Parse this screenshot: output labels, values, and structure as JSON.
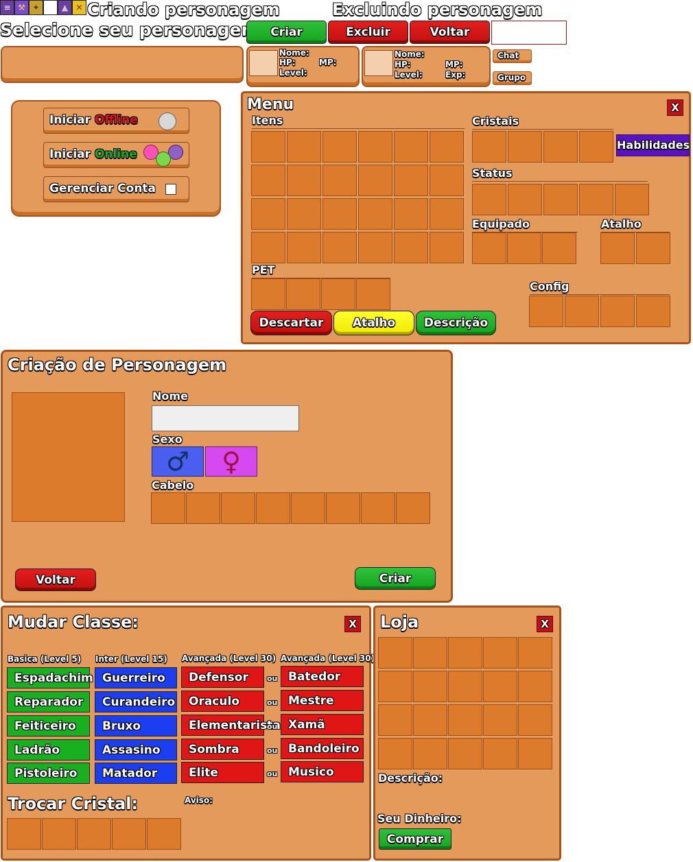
{
  "top": {
    "creating_title": "Criando personagem",
    "deleting_title": "Excluindo personagem",
    "select_title": "Selecione seu personagem",
    "create_label": "Criar",
    "delete_label": "Excluir",
    "back_label": "Voltar",
    "name_field_value": ""
  },
  "char_card_1": {
    "nome": "Nome:",
    "hp": "HP:",
    "mp": "MP:",
    "level": "Level:"
  },
  "char_card_2": {
    "nome": "Nome:",
    "hp": "HP:",
    "mp": "MP:",
    "level": "Level:",
    "exp": "Exp:"
  },
  "side_buttons": {
    "chat": "Chat",
    "grupo": "Grupo"
  },
  "start_menu": {
    "offline_prefix": "Iniciar ",
    "offline_word": "Offline",
    "online_prefix": "Iniciar ",
    "online_word": "Online",
    "manage": "Gerenciar Conta",
    "colors": {
      "offline": "#e01515",
      "online": "#18b021"
    }
  },
  "menu": {
    "title": "Menu",
    "close": "X",
    "itens": "Itens",
    "cristais": "Cristais",
    "habilidades": "Habilidades",
    "status": "Status",
    "equipado": "Equipado",
    "atalho": "Atalho",
    "pet": "PET",
    "config": "Config",
    "descartar": "Descartar",
    "atalho_btn": "Atalho",
    "descricao": "Descrição"
  },
  "creation": {
    "title": "Criação de Personagem",
    "nome": "Nome",
    "nome_value": "",
    "sexo": "Sexo",
    "male_icon": "♂",
    "female_icon": "♀",
    "cabelo": "Cabelo",
    "voltar": "Voltar",
    "criar": "Criar"
  },
  "class_change": {
    "title": "Mudar Classe:",
    "close": "X",
    "columns": [
      "Basica (Level 5)",
      "Inter (Level 15)",
      "Avançada (Level 30)",
      "Avançada (Level 30)"
    ],
    "basic": [
      "Espadachim",
      "Reparador",
      "Feiticeiro",
      "Ladrão",
      "Pistoleiro"
    ],
    "inter": [
      "Guerreiro",
      "Curandeiro",
      "Bruxo",
      "Assasino",
      "Matador"
    ],
    "adv_a": [
      "Defensor",
      "Oraculo",
      "Elementarista",
      "Sombra",
      "Elite"
    ],
    "adv_b": [
      "Batedor",
      "Mestre",
      "Xamã",
      "Bandoleiro",
      "Musico"
    ],
    "or_word": "ou",
    "crystal_title": "Trocar Cristal:",
    "aviso": "Aviso:"
  },
  "shop": {
    "title": "Loja",
    "close": "X",
    "descricao": "Descrição:",
    "dinheiro": "Seu Dinheiro:",
    "comprar": "Comprar"
  },
  "colors": {
    "panel": "#e39a5a",
    "slot": "#dd7b2c",
    "border": "#a8521b",
    "purple": "#5b12c4"
  }
}
